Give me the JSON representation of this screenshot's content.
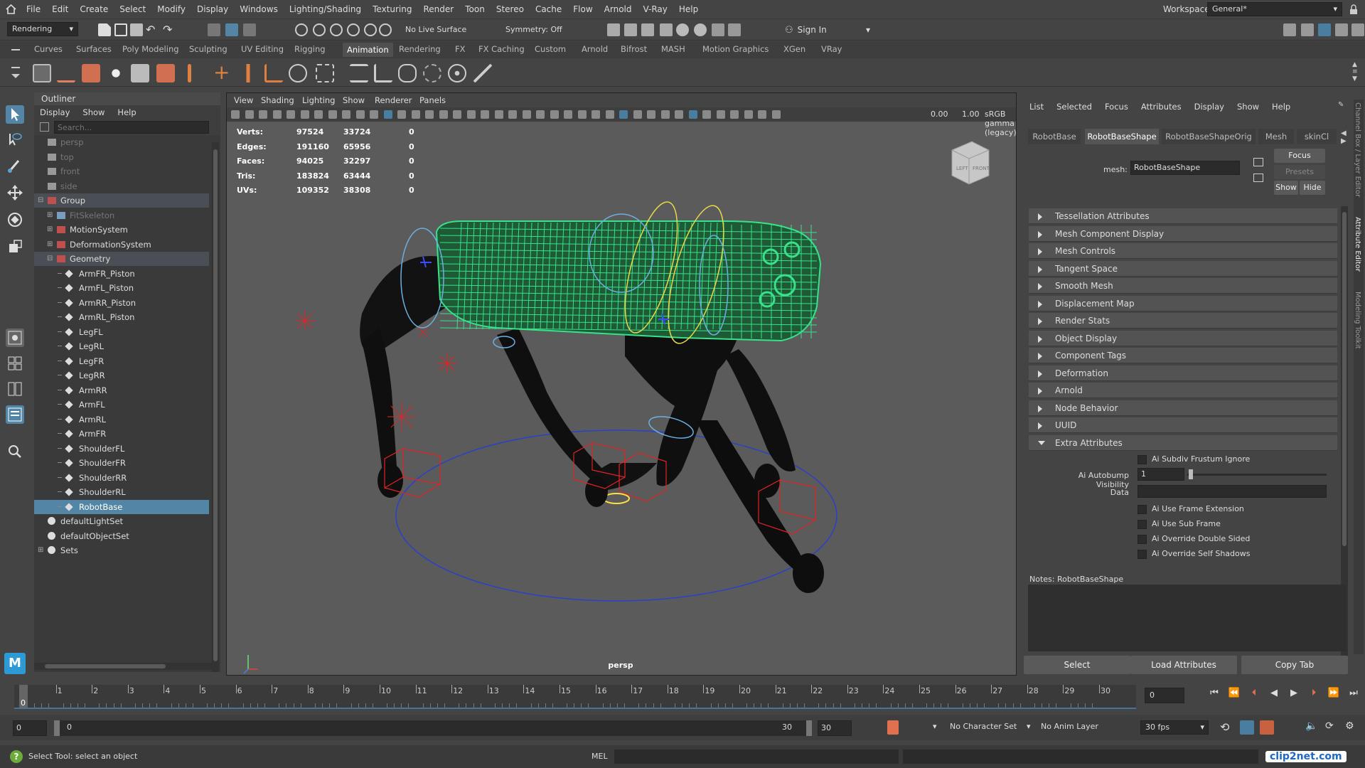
{
  "menubar": {
    "items": [
      "File",
      "Edit",
      "Create",
      "Select",
      "Modify",
      "Display",
      "Windows",
      "Lighting/Shading",
      "Texturing",
      "Render",
      "Toon",
      "Stereo",
      "Cache",
      "Flow",
      "Arnold",
      "V-Ray",
      "Help"
    ],
    "workspace_label": "Workspace:",
    "workspace_value": "General*"
  },
  "statusline": {
    "mode": "Rendering",
    "live_surface": "No Live Surface",
    "symmetry": "Symmetry: Off",
    "sign_in": "Sign In"
  },
  "shelf": {
    "tabs": [
      "Curves",
      "Surfaces",
      "Poly Modeling",
      "Sculpting",
      "UV Editing",
      "Rigging",
      "Animation",
      "Rendering",
      "FX",
      "FX Caching",
      "Custom",
      "Arnold",
      "Bifrost",
      "MASH",
      "Motion Graphics",
      "XGen",
      "VRay"
    ],
    "active_tab": "Animation"
  },
  "outliner": {
    "title": "Outliner",
    "menu": [
      "Display",
      "Show",
      "Help"
    ],
    "search_placeholder": "Search...",
    "items": [
      {
        "label": "persp",
        "indent": 1,
        "state": "dim",
        "kind": "camera"
      },
      {
        "label": "top",
        "indent": 1,
        "state": "dim",
        "kind": "camera"
      },
      {
        "label": "front",
        "indent": 1,
        "state": "dim",
        "kind": "camera"
      },
      {
        "label": "side",
        "indent": 1,
        "state": "dim",
        "kind": "camera"
      },
      {
        "label": "Group",
        "indent": 1,
        "state": "grp",
        "kind": "group",
        "exp": "minus"
      },
      {
        "label": "FitSkeleton",
        "indent": 2,
        "state": "dim",
        "kind": "joint",
        "exp": "plus"
      },
      {
        "label": "MotionSystem",
        "indent": 2,
        "state": "",
        "kind": "group",
        "exp": "plus"
      },
      {
        "label": "DeformationSystem",
        "indent": 2,
        "state": "",
        "kind": "group",
        "exp": "plus"
      },
      {
        "label": "Geometry",
        "indent": 2,
        "state": "grp",
        "kind": "group",
        "exp": "minus"
      },
      {
        "label": "ArmFR_Piston",
        "indent": 3,
        "state": "",
        "kind": "mesh"
      },
      {
        "label": "ArmFL_Piston",
        "indent": 3,
        "state": "",
        "kind": "mesh"
      },
      {
        "label": "ArmRR_Piston",
        "indent": 3,
        "state": "",
        "kind": "mesh"
      },
      {
        "label": "ArmRL_Piston",
        "indent": 3,
        "state": "",
        "kind": "mesh"
      },
      {
        "label": "LegFL",
        "indent": 3,
        "state": "",
        "kind": "mesh"
      },
      {
        "label": "LegRL",
        "indent": 3,
        "state": "",
        "kind": "mesh"
      },
      {
        "label": "LegFR",
        "indent": 3,
        "state": "",
        "kind": "mesh"
      },
      {
        "label": "LegRR",
        "indent": 3,
        "state": "",
        "kind": "mesh"
      },
      {
        "label": "ArmRR",
        "indent": 3,
        "state": "",
        "kind": "mesh"
      },
      {
        "label": "ArmFL",
        "indent": 3,
        "state": "",
        "kind": "mesh"
      },
      {
        "label": "ArmRL",
        "indent": 3,
        "state": "",
        "kind": "mesh"
      },
      {
        "label": "ArmFR",
        "indent": 3,
        "state": "",
        "kind": "mesh"
      },
      {
        "label": "ShoulderFL",
        "indent": 3,
        "state": "",
        "kind": "mesh"
      },
      {
        "label": "ShoulderFR",
        "indent": 3,
        "state": "",
        "kind": "mesh"
      },
      {
        "label": "ShoulderRR",
        "indent": 3,
        "state": "",
        "kind": "mesh"
      },
      {
        "label": "ShoulderRL",
        "indent": 3,
        "state": "",
        "kind": "mesh"
      },
      {
        "label": "RobotBase",
        "indent": 3,
        "state": "sel",
        "kind": "mesh"
      },
      {
        "label": "defaultLightSet",
        "indent": 1,
        "state": "",
        "kind": "set"
      },
      {
        "label": "defaultObjectSet",
        "indent": 1,
        "state": "",
        "kind": "set"
      },
      {
        "label": "Sets",
        "indent": 1,
        "state": "",
        "kind": "set",
        "exp": "plus"
      }
    ]
  },
  "viewport": {
    "menu": [
      "View",
      "Shading",
      "Lighting",
      "Show",
      "Renderer",
      "Panels"
    ],
    "exposure": "0.00",
    "gamma": "1.00",
    "colorspace": "sRGB gamma (legacy)",
    "camera_label": "persp",
    "cube_left": "LEFT",
    "cube_front": "FRONT",
    "hud": [
      {
        "label": "Verts:",
        "a": "97524",
        "b": "33724",
        "c": "0"
      },
      {
        "label": "Edges:",
        "a": "191160",
        "b": "65956",
        "c": "0"
      },
      {
        "label": "Faces:",
        "a": "94025",
        "b": "32297",
        "c": "0"
      },
      {
        "label": "Tris:",
        "a": "183824",
        "b": "63444",
        "c": "0"
      },
      {
        "label": "UVs:",
        "a": "109352",
        "b": "38308",
        "c": "0"
      }
    ]
  },
  "attribute_editor": {
    "menu": [
      "List",
      "Selected",
      "Focus",
      "Attributes",
      "Display",
      "Show",
      "Help"
    ],
    "tabs": [
      "RobotBase",
      "RobotBaseShape",
      "RobotBaseShapeOrig",
      "Mesh",
      "skinCl"
    ],
    "active_tab": "RobotBaseShape",
    "mesh_label": "mesh:",
    "mesh_value": "RobotBaseShape",
    "focus_btn": "Focus",
    "presets_btn": "Presets",
    "show_btn": "Show",
    "hide_btn": "Hide",
    "sections": [
      "Tessellation Attributes",
      "Mesh Component Display",
      "Mesh Controls",
      "Tangent Space",
      "Smooth Mesh",
      "Displacement Map",
      "Render Stats",
      "Object Display",
      "Component Tags",
      "Deformation",
      "Arnold",
      "Node Behavior",
      "UUID",
      "Extra Attributes"
    ],
    "extra": {
      "subdiv_frustum": "Ai Subdiv Frustum Ignore",
      "autobump_label": "Ai Autobump Visibility",
      "autobump_value": "1",
      "data_label": "Data",
      "use_frame_ext": "Ai Use Frame Extension",
      "use_sub_frame": "Ai Use Sub Frame",
      "override_double": "Ai Override Double Sided",
      "override_shadows": "Ai Override Self Shadows"
    },
    "notes_label": "Notes:  RobotBaseShape",
    "bottom_buttons": [
      "Select",
      "Load Attributes",
      "Copy Tab"
    ],
    "side_tabs": [
      "Channel Box / Layer Editor",
      "Attribute Editor",
      "Modeling Toolkit"
    ]
  },
  "timeline": {
    "ticks": [
      "0",
      "1",
      "2",
      "3",
      "4",
      "5",
      "6",
      "7",
      "8",
      "9",
      "10",
      "11",
      "12",
      "13",
      "14",
      "15",
      "16",
      "17",
      "18",
      "19",
      "20",
      "21",
      "22",
      "23",
      "24",
      "25",
      "26",
      "27",
      "28",
      "29",
      "30"
    ],
    "current_frame": "0",
    "frame_field": "0"
  },
  "range": {
    "start": "0",
    "range_start": "0",
    "range_end": "30",
    "end": "30",
    "character_set": "No Character Set",
    "anim_layer": "No Anim Layer",
    "fps": "30 fps"
  },
  "helpline": {
    "text": "Select Tool: select an object",
    "mel_label": "MEL",
    "watermark": "clip2net.com"
  },
  "colors": {
    "selection": "#5285a6",
    "wireframe": "#39e28a",
    "active_tab_bg": "#505050"
  }
}
